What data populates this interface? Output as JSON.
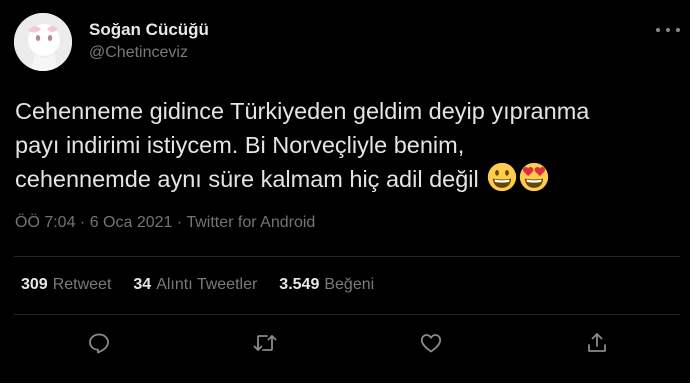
{
  "user": {
    "display_name": "Soğan Cücüğü",
    "handle": "@Chetinceviz"
  },
  "tweet": {
    "lines": [
      "Cehenneme gidince Türkiyeden geldim deyip yıpranma",
      "payı indirimi istiycem. Bi Norveçliyle benim,",
      "cehennemde aynı süre kalmam hiç adil değil"
    ],
    "emojis": [
      "grinning-face",
      "smiling-face-with-heart-eyes"
    ]
  },
  "meta": {
    "text": "ÖÖ 7:04 · 6 Oca 2021 · Twitter for Android"
  },
  "stats": {
    "retweets": {
      "count": "309",
      "label": "Retweet"
    },
    "quotes": {
      "count": "34",
      "label": "Alıntı Tweetler"
    },
    "likes": {
      "count": "3.549",
      "label": "Beğeni"
    }
  },
  "actions": [
    "reply-icon",
    "retweet-icon",
    "like-icon",
    "share-icon"
  ],
  "colors": {
    "background": "#000000",
    "primary_text": "#e4e4e4",
    "secondary_text": "#747474",
    "divider": "#262626",
    "icon": "#8a8a8a"
  }
}
